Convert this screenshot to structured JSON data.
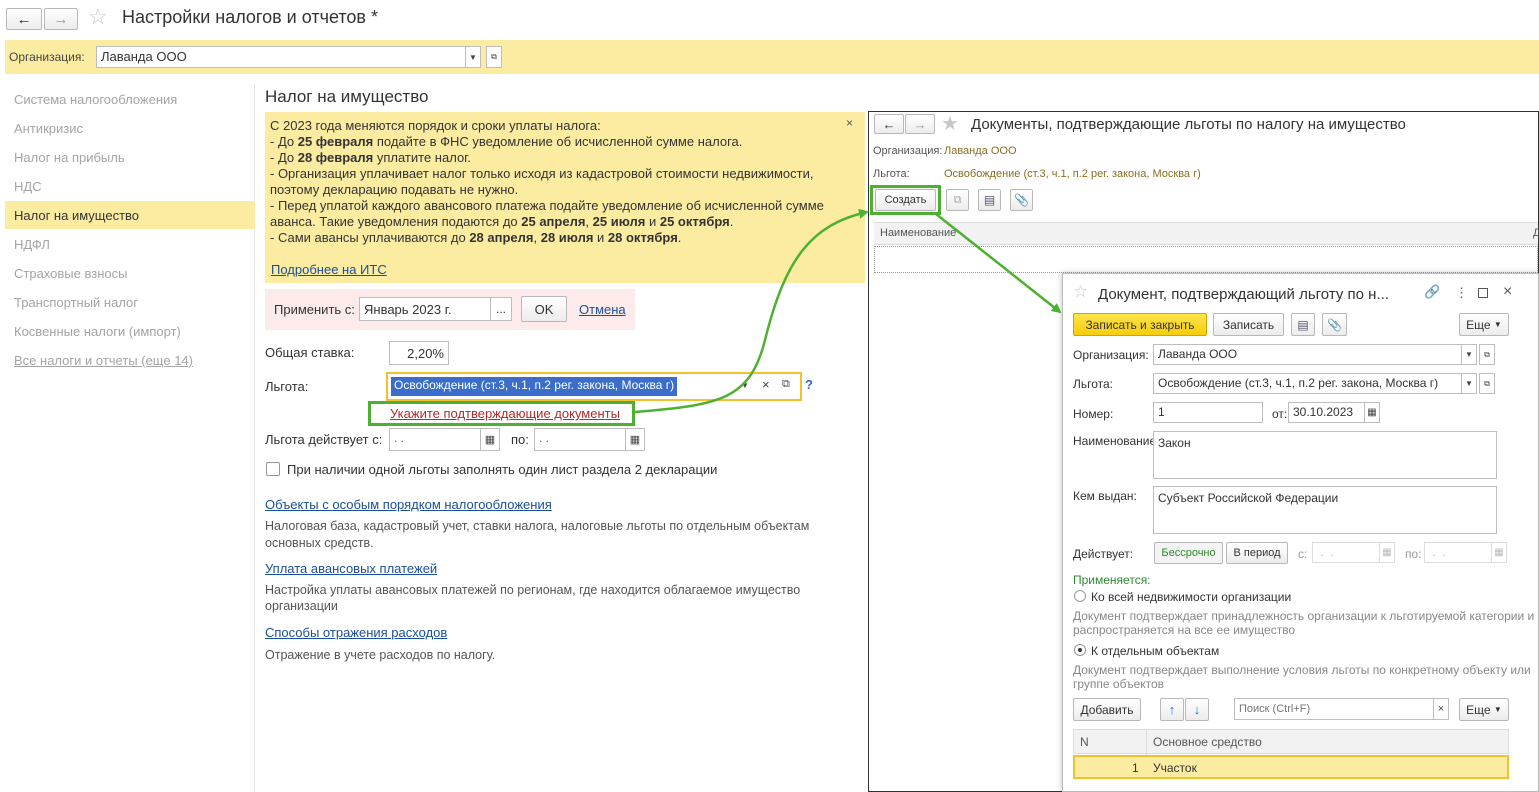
{
  "window": {
    "title": "Настройки налогов и отчетов *"
  },
  "org_bar": {
    "label": "Организация:",
    "value": "Лаванда ООО"
  },
  "sidebar": {
    "items": [
      {
        "label": "Система налогообложения"
      },
      {
        "label": "Антикризис"
      },
      {
        "label": "Налог на прибыль"
      },
      {
        "label": "НДС"
      },
      {
        "label": "Налог на имущество"
      },
      {
        "label": "НДФЛ"
      },
      {
        "label": "Страховые взносы"
      },
      {
        "label": "Транспортный налог"
      },
      {
        "label": "Косвенные налоги (импорт)"
      },
      {
        "label": "Все налоги и отчеты (еще 14)"
      }
    ]
  },
  "main": {
    "title": "Налог на имущество",
    "notice": {
      "intro": "С 2023 года меняются порядок и сроки уплаты налога:",
      "l1_pre": " - До ",
      "l1_b": "25 февраля",
      "l1_post": " подайте в ФНС уведомление об исчисленной сумме налога.",
      "l2_pre": " - До ",
      "l2_b": "28 февраля",
      "l2_post": " уплатите налог.",
      "l3a": " - Организация уплачивает налог только исходя из кадастровой стоимости недвижимости,",
      "l3b": "поэтому декларацию подавать не нужно.",
      "l4a": " - Перед уплатой каждого авансового платежа подайте уведомление об исчисленной сумме",
      "l4b_pre": "аванса. Такие уведомления подаются до ",
      "l4b_b1": "25 апреля",
      "l4b_c1": ", ",
      "l4b_b2": "25 июля",
      "l4b_c2": " и ",
      "l4b_b3": "25 октября",
      "l4b_end": ".",
      "l5_pre": " - Сами авансы уплачиваются до ",
      "l5_b1": "28 апреля",
      "l5_c1": ", ",
      "l5_b2": "28 июля",
      "l5_c2": " и ",
      "l5_b3": "28 октября",
      "l5_end": ".",
      "more_link": "Подробнее на ИТС",
      "close": "×"
    },
    "apply": {
      "label": "Применить с:",
      "value": "Январь 2023 г.",
      "dots": "...",
      "ok": "OK",
      "cancel": "Отмена"
    },
    "rate": {
      "label": "Общая ставка:",
      "value": "2,20%"
    },
    "benefit": {
      "label": "Льгота:",
      "value": "Освобождение (ст.3, ч.1, п.2 рег. закона, Москва г)",
      "help": "?",
      "docs_link": "Укажите подтверждающие документы"
    },
    "period": {
      "label": "Льгота действует с:",
      "from": " .  .",
      "to_label": "по:",
      "to": " .  ."
    },
    "checkbox_label": "При наличии одной льготы заполнять один лист раздела 2 декларации",
    "sections": [
      {
        "link": "Объекты с особым порядком налогообложения",
        "desc1": "Налоговая база, кадастровый учет, ставки налога, налоговые льготы по отдельным объектам",
        "desc2": "основных средств."
      },
      {
        "link": "Уплата авансовых платежей",
        "desc1": "Настройка уплаты авансовых платежей по регионам, где находится облагаемое имущество",
        "desc2": "организации"
      },
      {
        "link": "Способы отражения расходов",
        "desc1": "Отражение в учете расходов по налогу.",
        "desc2": ""
      }
    ]
  },
  "list_window": {
    "title": "Документы, подтверждающие льготы по налогу на имущество",
    "org_label": "Организация:",
    "org_value": "Лаванда ООО",
    "benefit_label": "Льгота:",
    "benefit_value": "Освобождение (ст.3, ч.1, п.2 рег. закона, Москва г)",
    "create": "Создать",
    "col_name": "Наименование",
    "col_trunc": "Д"
  },
  "doc_window": {
    "title": "Документ, подтверждающий льготу по н...",
    "save_close": "Записать и закрыть",
    "save": "Записать",
    "more": "Еще",
    "org_label": "Организация:",
    "org_value": "Лаванда ООО",
    "benefit_label": "Льгота:",
    "benefit_value": "Освобождение (ст.3, ч.1, п.2 рег. закона, Москва г)",
    "number_label": "Номер:",
    "number_value": "1",
    "date_label": "от:",
    "date_value": "30.10.2023",
    "name_label": "Наименование:",
    "name_value": "Закон",
    "issuer_label": "Кем выдан:",
    "issuer_value": "Субъект Российской Федерации",
    "valid_label": "Действует:",
    "perpetual": "Бессрочно",
    "in_period": "В период",
    "from_label": "с:",
    "to_label": "по:",
    "applies_label": "Применяется:",
    "radio1": "Ко всей недвижимости организации",
    "radio1_desc1": "Документ подтверждает принадлежность организации к льготируемой категории и",
    "radio1_desc2": "распространяется на все ее имущество",
    "radio2": "К отдельным объектам",
    "radio2_desc1": "Документ подтверждает выполнение условия льготы по конкретному объекту или",
    "radio2_desc2": "группе объектов",
    "add": "Добавить",
    "search_placeholder": "Поиск (Ctrl+F)",
    "more2": "Еще",
    "table": {
      "headers": [
        "N",
        "Основное средство"
      ],
      "rows": [
        [
          "1",
          "Участок"
        ]
      ]
    }
  }
}
